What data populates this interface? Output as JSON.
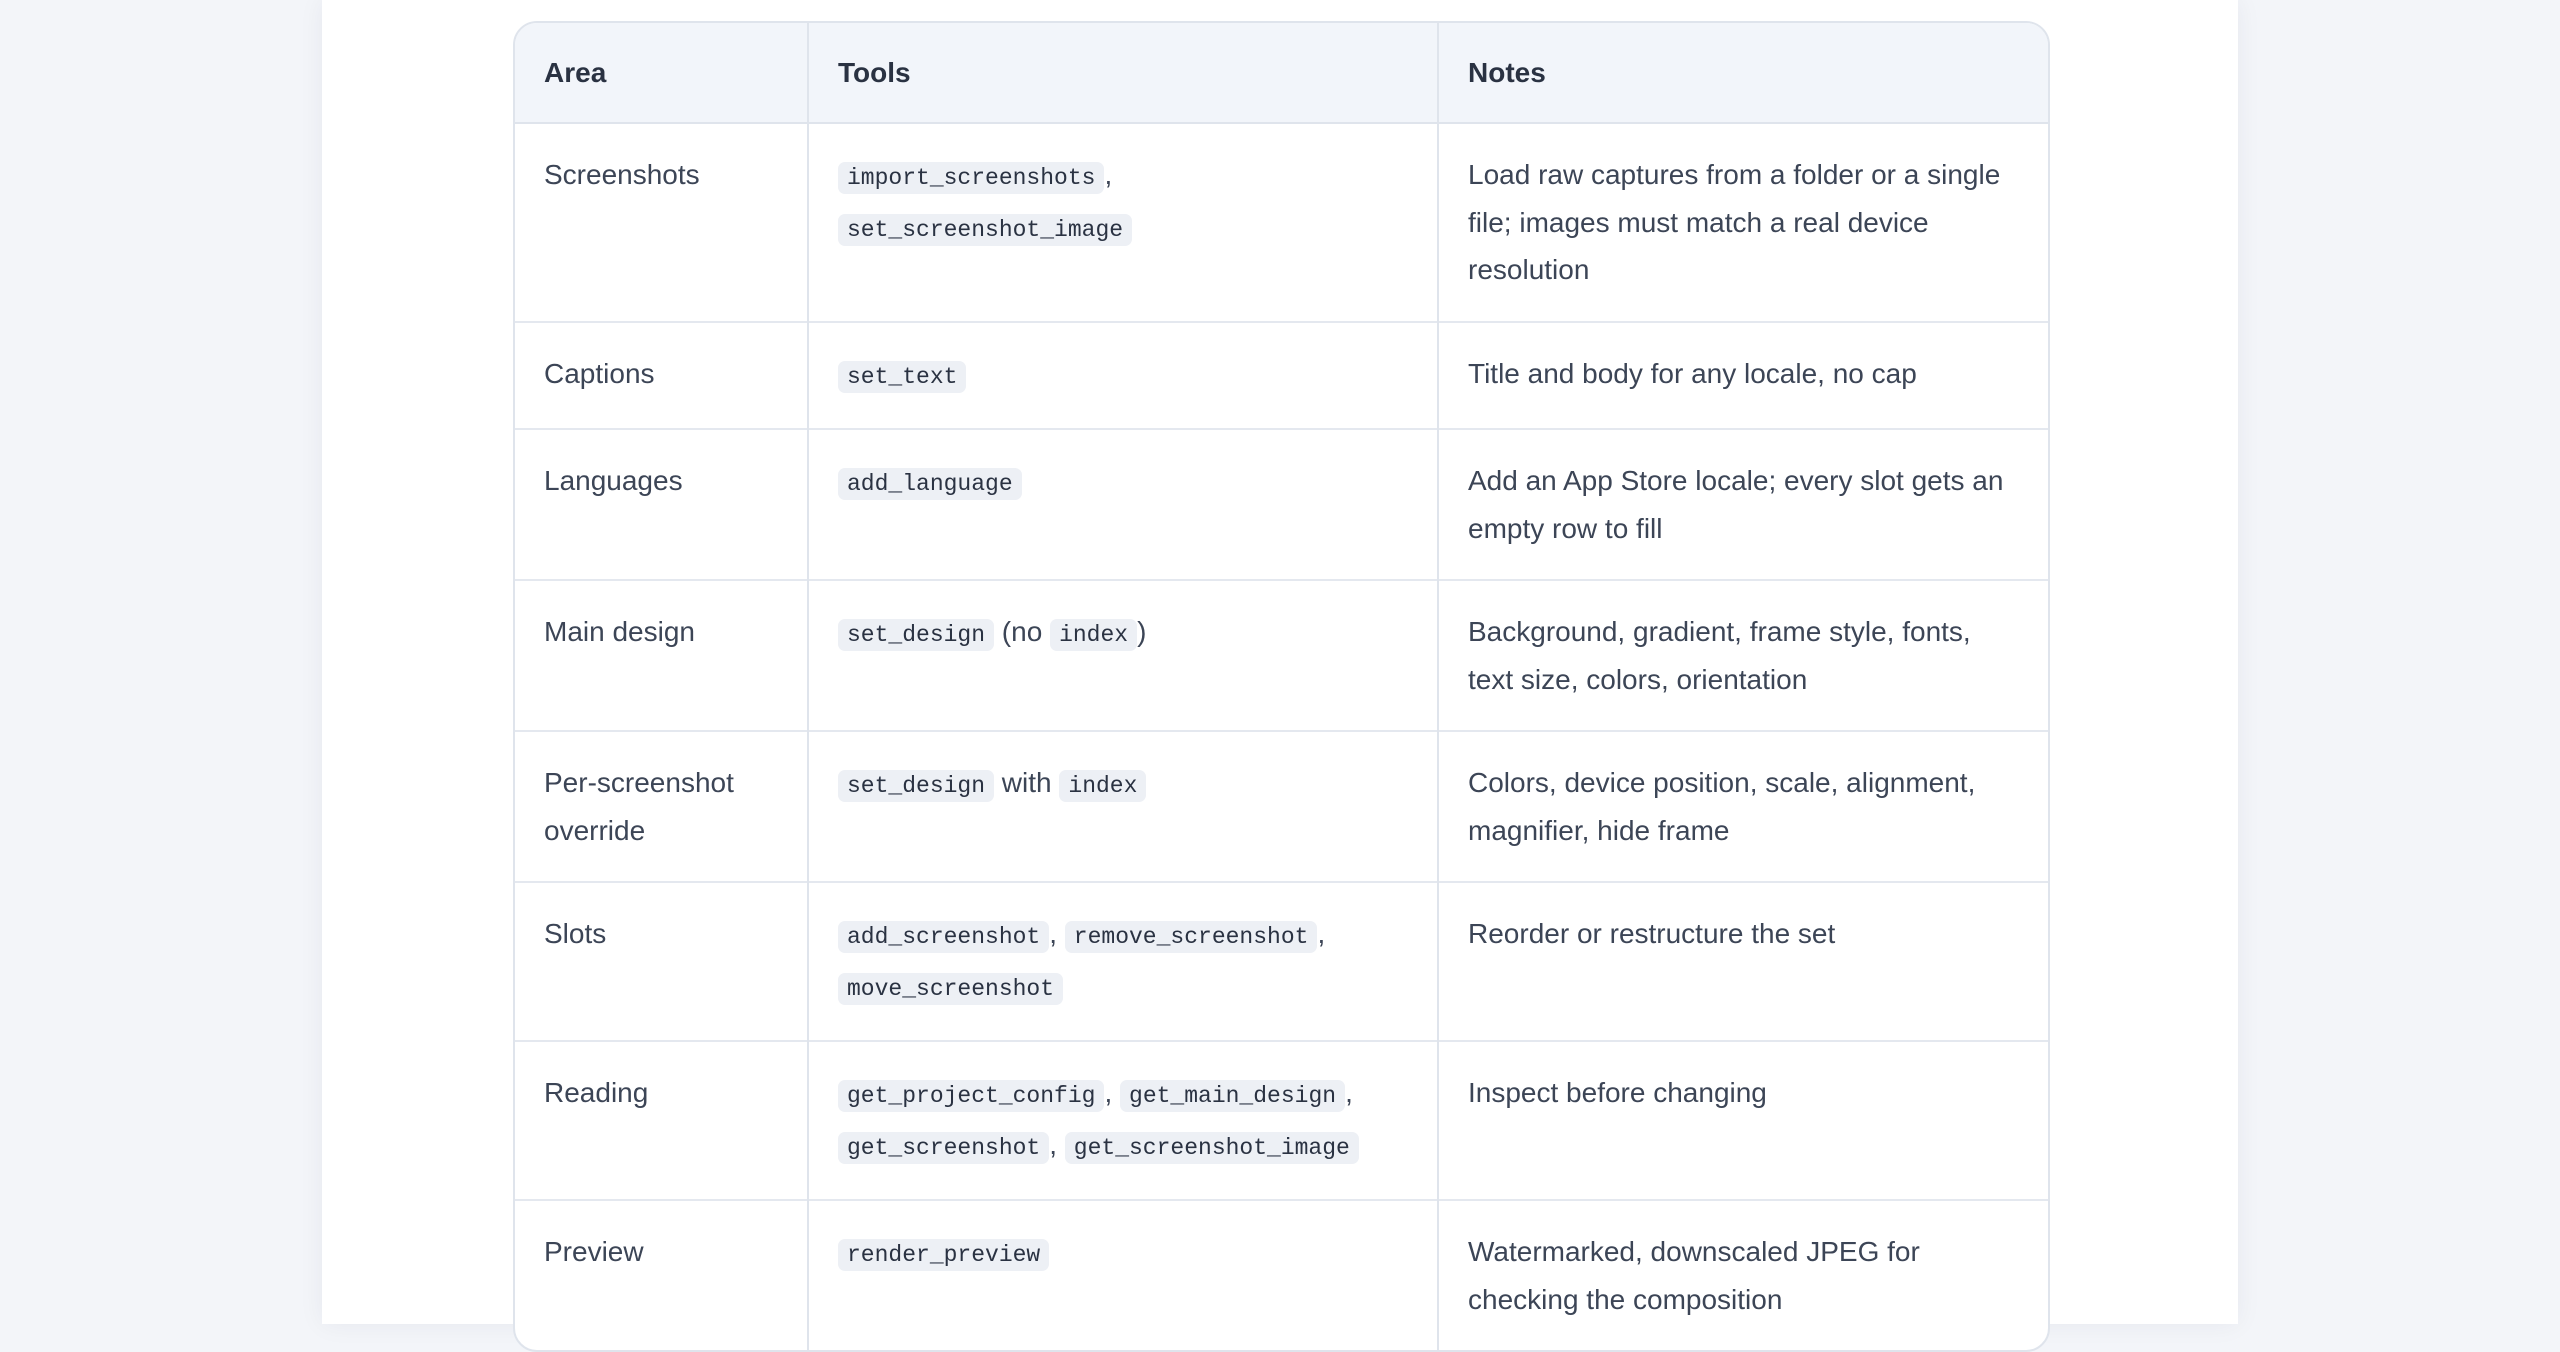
{
  "table": {
    "headers": {
      "area": "Area",
      "tools": "Tools",
      "notes": "Notes"
    },
    "rows": [
      {
        "area": "Screenshots",
        "tools": [
          {
            "t": "code",
            "v": "import_screenshots"
          },
          {
            "t": "text",
            "v": ", "
          },
          {
            "t": "code",
            "v": "set_screenshot_image"
          }
        ],
        "notes": "Load raw captures from a folder or a single file; images must match a real device resolution"
      },
      {
        "area": "Captions",
        "tools": [
          {
            "t": "code",
            "v": "set_text"
          }
        ],
        "notes": "Title and body for any locale, no cap"
      },
      {
        "area": "Languages",
        "tools": [
          {
            "t": "code",
            "v": "add_language"
          }
        ],
        "notes": "Add an App Store locale; every slot gets an empty row to fill"
      },
      {
        "area": "Main design",
        "tools": [
          {
            "t": "code",
            "v": "set_design"
          },
          {
            "t": "text",
            "v": " (no "
          },
          {
            "t": "code",
            "v": "index"
          },
          {
            "t": "text",
            "v": ")"
          }
        ],
        "notes": "Background, gradient, frame style, fonts, text size, colors, orientation"
      },
      {
        "area": "Per-screenshot override",
        "tools": [
          {
            "t": "code",
            "v": "set_design"
          },
          {
            "t": "text",
            "v": " with "
          },
          {
            "t": "code",
            "v": "index"
          }
        ],
        "notes": "Colors, device position, scale, alignment, magnifier, hide frame"
      },
      {
        "area": "Slots",
        "tools": [
          {
            "t": "code",
            "v": "add_screenshot"
          },
          {
            "t": "text",
            "v": ", "
          },
          {
            "t": "code",
            "v": "remove_screenshot"
          },
          {
            "t": "text",
            "v": ", "
          },
          {
            "t": "code",
            "v": "move_screenshot"
          }
        ],
        "notes": "Reorder or restructure the set"
      },
      {
        "area": "Reading",
        "tools": [
          {
            "t": "code",
            "v": "get_project_config"
          },
          {
            "t": "text",
            "v": ", "
          },
          {
            "t": "code",
            "v": "get_main_design"
          },
          {
            "t": "text",
            "v": ", "
          },
          {
            "t": "code",
            "v": "get_screenshot"
          },
          {
            "t": "text",
            "v": ", "
          },
          {
            "t": "code",
            "v": "get_screenshot_image"
          }
        ],
        "notes": "Inspect before changing"
      },
      {
        "area": "Preview",
        "tools": [
          {
            "t": "code",
            "v": "render_preview"
          }
        ],
        "notes": "Watermarked, downscaled JPEG for checking the composition"
      }
    ]
  }
}
